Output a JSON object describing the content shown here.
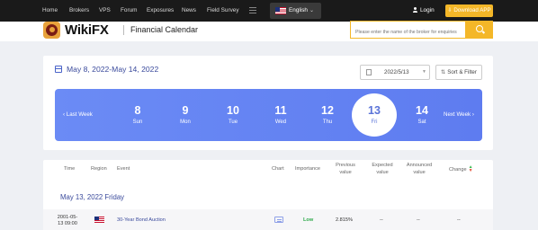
{
  "topnav": {
    "items": [
      "Home",
      "Brokers",
      "VPS",
      "Forum",
      "Exposures",
      "News",
      "Field Survey"
    ],
    "language": "English",
    "login": "Login",
    "download": "Download APP"
  },
  "brand": {
    "logo": "WikiFX",
    "page_title": "Financial Calendar",
    "search_placeholder": "Please enter the name of the broker for enquiries"
  },
  "calendar": {
    "range": "May 8, 2022-May 14, 2022",
    "selected_date": "2022/5/13",
    "sort_filter": "Sort & Filter",
    "last_week": "‹ Last Week",
    "next_week": "Next Week ›",
    "days": [
      {
        "num": "8",
        "dow": "Sun"
      },
      {
        "num": "9",
        "dow": "Mon"
      },
      {
        "num": "10",
        "dow": "Tue"
      },
      {
        "num": "11",
        "dow": "Wed"
      },
      {
        "num": "12",
        "dow": "Thu"
      },
      {
        "num": "13",
        "dow": "Fri"
      },
      {
        "num": "14",
        "dow": "Sat"
      }
    ]
  },
  "table": {
    "headers": {
      "time": "Time",
      "region": "Region",
      "event": "Event",
      "chart": "Chart",
      "importance": "Importance",
      "previous_line1": "Previous",
      "previous_line2": "value",
      "expected_line1": "Expected",
      "expected_line2": "value",
      "announced_line1": "Announced",
      "announced_line2": "value",
      "change": "Change"
    },
    "group_date": "May 13, 2022 Friday",
    "rows": [
      {
        "time_line1": "2001-05-",
        "time_line2": "13 09:00",
        "event": "30-Year Bond Auction",
        "importance": "Low",
        "previous": "2.815%",
        "expected": "--",
        "announced": "--",
        "change": "--"
      }
    ]
  },
  "colors": {
    "accent_yellow": "#f4b728",
    "week_strip": "#6282f2",
    "link_blue": "#3a4a9c",
    "importance_low": "#2eaa4a"
  }
}
